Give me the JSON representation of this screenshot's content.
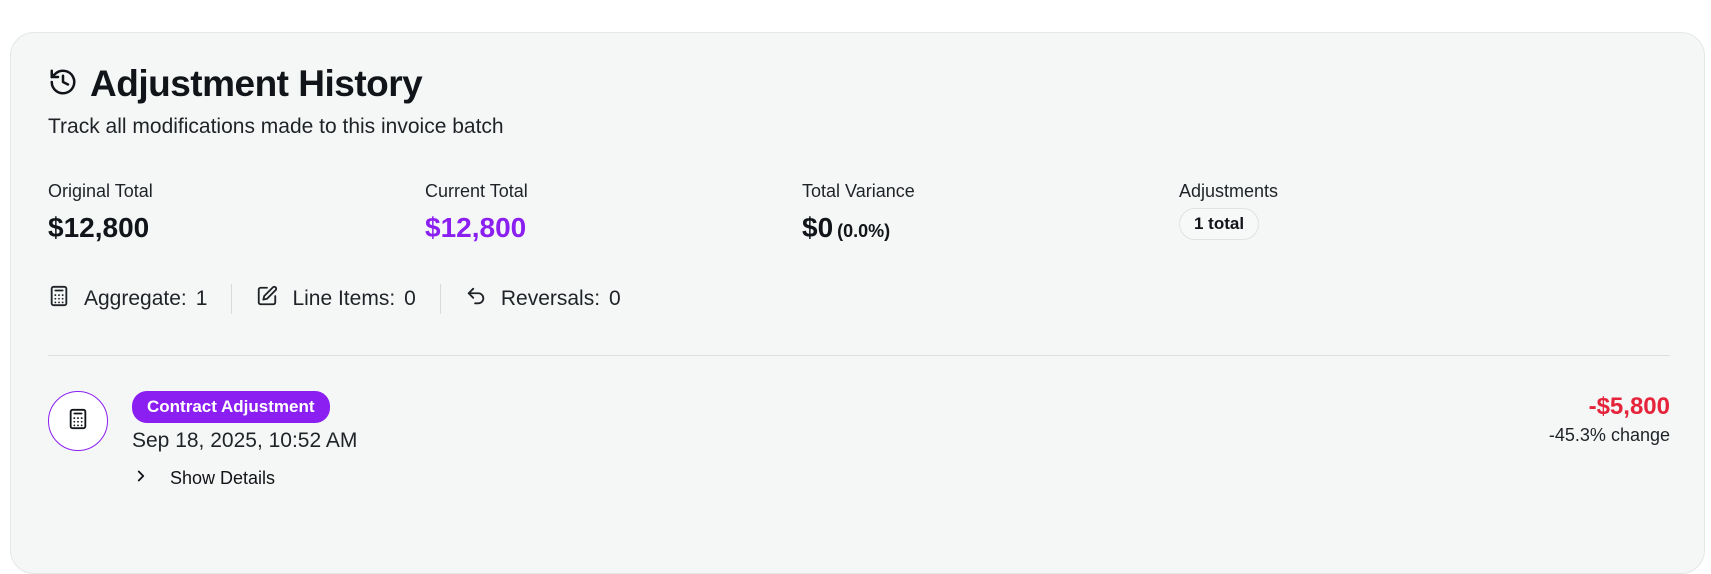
{
  "header": {
    "title": "Adjustment History",
    "subtitle": "Track all modifications made to this invoice batch",
    "icon": "history-icon"
  },
  "stats": {
    "original": {
      "label": "Original Total",
      "value": "$12,800"
    },
    "current": {
      "label": "Current Total",
      "value": "$12,800"
    },
    "variance": {
      "label": "Total Variance",
      "value": "$0",
      "percent": "(0.0%)"
    },
    "adjustments": {
      "label": "Adjustments",
      "value": "1 total"
    }
  },
  "counts": {
    "aggregate": {
      "label": "Aggregate:",
      "value": "1",
      "icon": "calculator-icon"
    },
    "line_items": {
      "label": "Line Items:",
      "value": "0",
      "icon": "edit-icon"
    },
    "reversals": {
      "label": "Reversals:",
      "value": "0",
      "icon": "undo-icon"
    }
  },
  "entry": {
    "badge": "Contract Adjustment",
    "timestamp": "Sep 18, 2025, 10:52 AM",
    "details_label": "Show Details",
    "amount": "-$5,800",
    "change": "-45.3% change",
    "icon": "calculator-icon"
  },
  "colors": {
    "accent": "#8b1ff2",
    "negative": "#e5243b",
    "card_bg": "#f5f7f6"
  }
}
